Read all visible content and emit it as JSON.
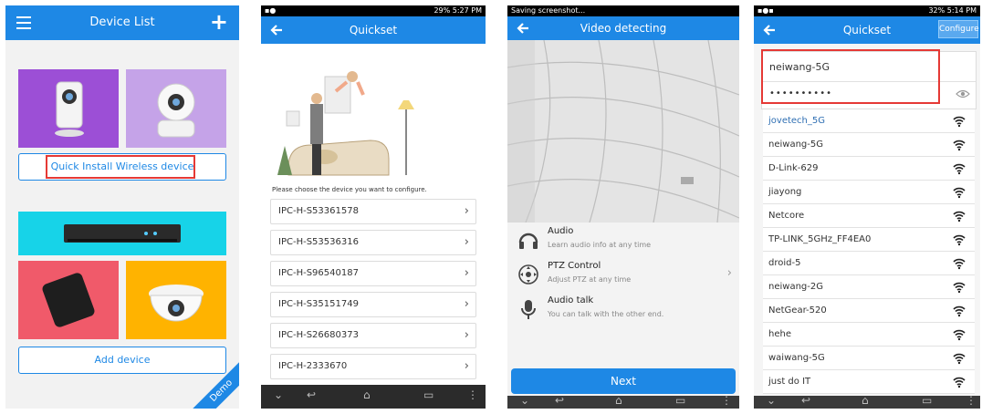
{
  "panel1": {
    "title": "Device List",
    "quick_install_label": "Quick Install Wireless device",
    "add_device_label": "Add device",
    "demo_badge": "Demo"
  },
  "panel2": {
    "status_time": "29% 5:27 PM",
    "title": "Quickset",
    "instruction": "Please choose the device you want to configure.",
    "devices": [
      "IPC-H-S53361578",
      "IPC-H-S53536316",
      "IPC-H-S96540187",
      "IPC-H-S35151749",
      "IPC-H-S26680373",
      "IPC-H-2333670"
    ]
  },
  "panel3": {
    "status_text": "Saving screenshot...",
    "title": "Video detecting",
    "options": [
      {
        "title": "Audio",
        "subtitle": "Learn audio info at any time"
      },
      {
        "title": "PTZ Control",
        "subtitle": "Adjust PTZ at any time"
      },
      {
        "title": "Audio talk",
        "subtitle": "You can talk with the other end."
      }
    ],
    "next_label": "Next"
  },
  "panel4": {
    "status_time": "32% 5:14 PM",
    "title": "Quickset",
    "configure_label": "Configure",
    "ssid_value": "neiwang-5G",
    "password_value": "••••••••••",
    "networks": [
      "jovetech_5G",
      "neiwang-5G",
      "D-Link-629",
      "jiayong",
      "Netcore",
      "TP-LINK_5GHz_FF4EA0",
      "droid-5",
      "neiwang-2G",
      "NetGear-520",
      "hehe",
      "waiwang-5G",
      "just do IT"
    ]
  },
  "colors": {
    "accent": "#1e88e5",
    "highlight": "#e53935"
  }
}
